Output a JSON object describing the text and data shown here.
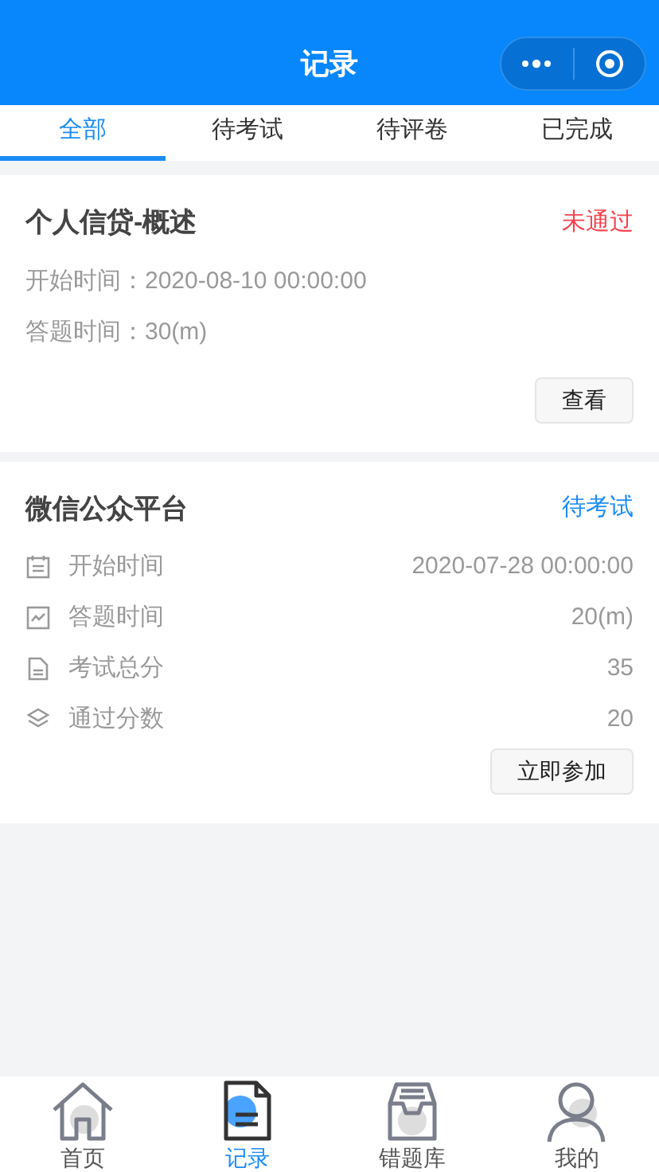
{
  "header": {
    "title": "记录"
  },
  "tabs": [
    {
      "label": "全部",
      "selected": true
    },
    {
      "label": "待考试",
      "selected": false
    },
    {
      "label": "待评卷",
      "selected": false
    },
    {
      "label": "已完成",
      "selected": false
    }
  ],
  "records": [
    {
      "kind": "simple",
      "title": "个人信贷-概述",
      "status": "未通过",
      "color": "#f5444f",
      "fields": [
        {
          "label": "开始时间：",
          "value": "2020-08-10 00:00:00"
        },
        {
          "label": "答题时间：",
          "value": "30(m)"
        }
      ],
      "action": "查看"
    },
    {
      "kind": "detailed",
      "title": "微信公众平台",
      "status": "待考试",
      "color": "#1a8cf5",
      "fields": [
        {
          "kind": "calendar",
          "label": "开始时间",
          "value": "2020-07-28 00:00:00"
        },
        {
          "kind": "chart",
          "label": "答题时间",
          "value": "20(m)"
        },
        {
          "kind": "document",
          "label": "考试总分",
          "value": "35"
        },
        {
          "kind": "layers",
          "label": "通过分数",
          "value": "20"
        }
      ],
      "action": "立即参加"
    }
  ],
  "nav": [
    {
      "kind": "home",
      "label": "首页",
      "selected": false
    },
    {
      "kind": "record",
      "label": "记录",
      "selected": true
    },
    {
      "kind": "inbox",
      "label": "错题库",
      "selected": false
    },
    {
      "kind": "user",
      "label": "我的",
      "selected": false
    }
  ]
}
